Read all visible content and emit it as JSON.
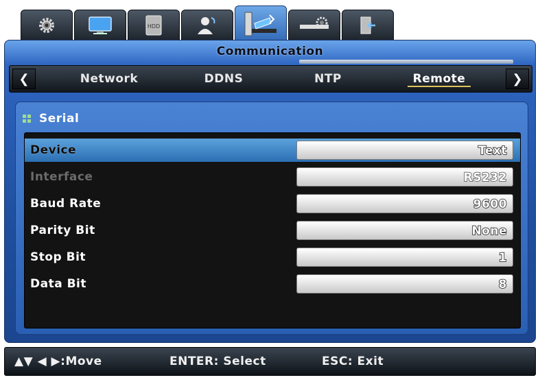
{
  "window": {
    "title": "Communication"
  },
  "icon_tabs": [
    {
      "icon": "gear-icon"
    },
    {
      "icon": "monitor-icon"
    },
    {
      "icon": "hdd-icon",
      "label": "HDD"
    },
    {
      "icon": "user-icon"
    },
    {
      "icon": "network-icon"
    },
    {
      "icon": "device-settings-icon"
    },
    {
      "icon": "exit-icon"
    }
  ],
  "subtabs": [
    {
      "label": "Network"
    },
    {
      "label": "DDNS"
    },
    {
      "label": "NTP"
    },
    {
      "label": "Remote",
      "active": true
    }
  ],
  "panel": {
    "title": "Serial",
    "rows": [
      {
        "label": "Device",
        "value": "Text",
        "selected": true
      },
      {
        "label": "Interface",
        "value": "RS232",
        "disabled": true
      },
      {
        "label": "Baud Rate",
        "value": "9600"
      },
      {
        "label": "Parity Bit",
        "value": "None"
      },
      {
        "label": "Stop Bit",
        "value": "1"
      },
      {
        "label": "Data Bit",
        "value": "8"
      }
    ]
  },
  "statusbar": {
    "move": ":Move",
    "select": "ENTER: Select",
    "exit": "ESC: Exit"
  },
  "colors": {
    "accent": "#2f66c2",
    "active_tab_underline": "#e0c25a",
    "selected_row": "#4a92d0"
  }
}
